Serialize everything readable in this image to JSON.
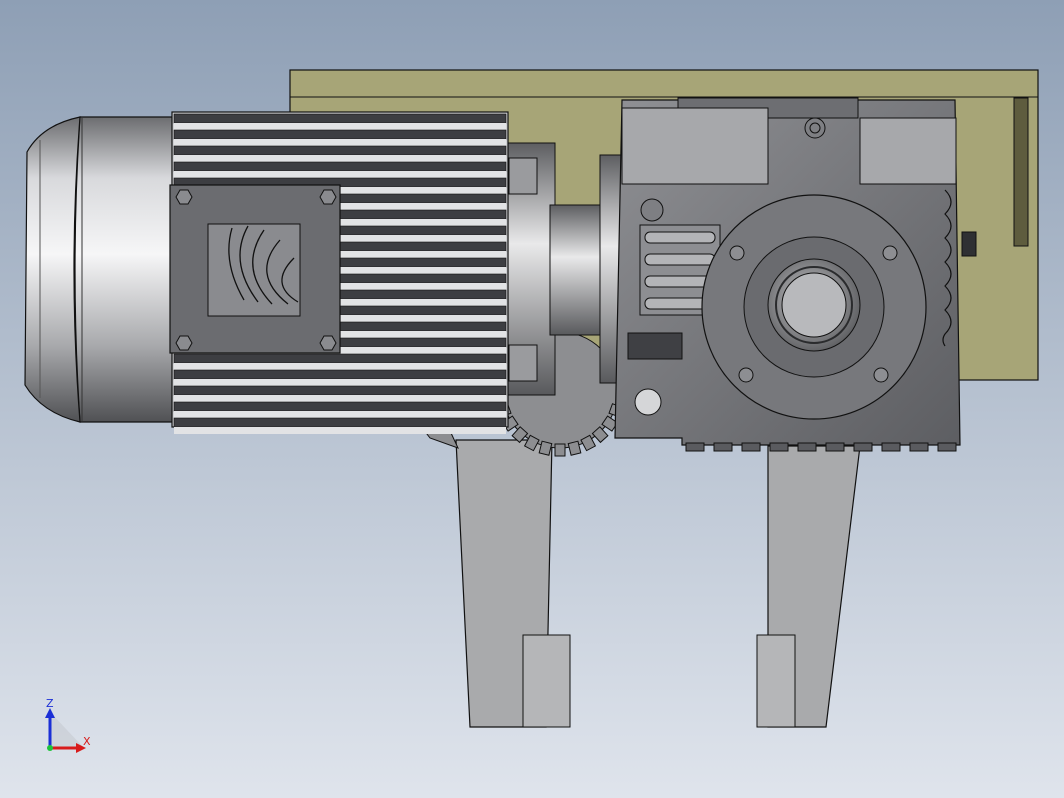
{
  "viewport": {
    "background_top": "#8e9fb5",
    "background_bottom": "#dfe4ec"
  },
  "triad": {
    "z_label": "Z",
    "x_label": "X",
    "z_color": "#1b2fd6",
    "x_color": "#d81b1b",
    "y_color": "#1ec43a"
  },
  "colors": {
    "base_plate": "#a7a577",
    "motor_silver": "#c7c8cb",
    "motor_dark": "#3f4044",
    "gearbox": "#6f7074",
    "gearbox_light": "#8d8e92",
    "legs": "#a9aaac",
    "outline": "#111111"
  }
}
